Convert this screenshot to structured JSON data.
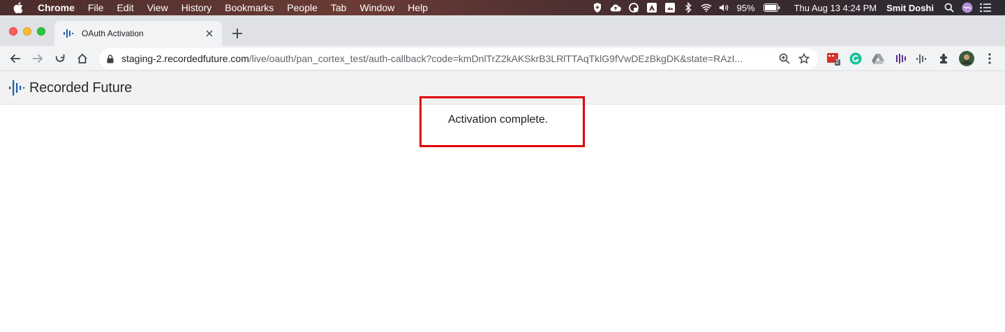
{
  "menubar": {
    "app_name": "Chrome",
    "items": [
      "File",
      "Edit",
      "View",
      "History",
      "Bookmarks",
      "People",
      "Tab",
      "Window",
      "Help"
    ],
    "battery_percent": "95%",
    "datetime": "Thu Aug 13  4:24 PM",
    "user": "Smit Doshi"
  },
  "tab": {
    "title": "OAuth Activation"
  },
  "omnibox": {
    "host": "staging-2.recordedfuture.com",
    "path": "/live/oauth/pan_cortex_test/auth-callback?code=kmDnlTrZ2kAKSkrB3LRlTTAqTklG9fVwDEzBkgDK&state=RAzI..."
  },
  "extensions": {
    "badge_count": "2"
  },
  "page": {
    "logo_text": "Recorded Future",
    "message": "Activation complete."
  },
  "colors": {
    "highlight_border": "#e00000",
    "logo_blue": "#1f5fa8"
  }
}
